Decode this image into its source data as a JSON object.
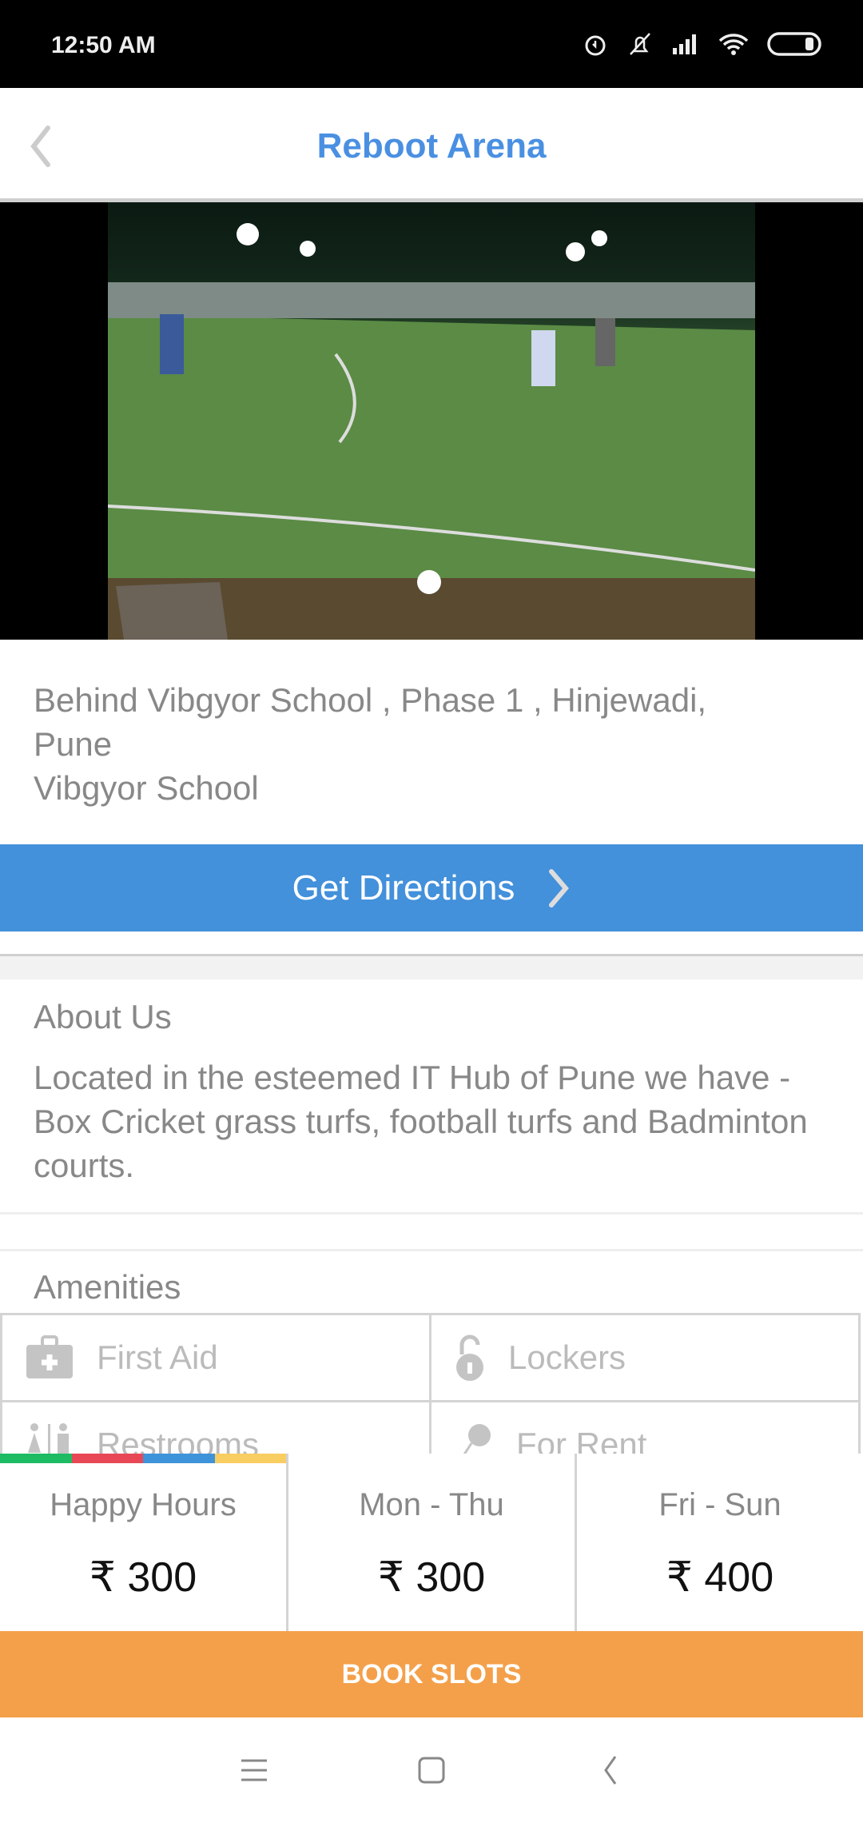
{
  "status_bar": {
    "time": "12:50 AM",
    "icons": [
      "alarm-icon",
      "mute-icon",
      "signal-icon",
      "wifi-icon",
      "battery-icon"
    ]
  },
  "header": {
    "title": "Reboot Arena",
    "back_icon": "chevron-left-icon"
  },
  "gallery": {
    "page_count": 1,
    "current_page": 1
  },
  "address": {
    "lines": [
      "Behind Vibgyor School , Phase 1 , Hinjewadi,",
      "Pune",
      "Vibgyor School"
    ]
  },
  "directions": {
    "label": "Get Directions"
  },
  "about": {
    "heading": "About Us",
    "text": "Located in the esteemed IT Hub of Pune we have - Box Cricket grass turfs, football turfs and Badminton courts."
  },
  "amenities": {
    "heading": "Amenities",
    "items": [
      {
        "label": "First Aid",
        "icon": "first-aid-icon"
      },
      {
        "label": "Lockers",
        "icon": "lock-icon"
      },
      {
        "label": "Restrooms",
        "icon": "restroom-icon"
      },
      {
        "label": "For Rent",
        "icon": "racket-icon"
      }
    ]
  },
  "prices": [
    {
      "label": "Happy Hours",
      "value": "₹ 300"
    },
    {
      "label": "Mon - Thu",
      "value": "₹ 300"
    },
    {
      "label": "Fri - Sun",
      "value": "₹ 400"
    }
  ],
  "strip_colors": [
    "#1dbb63",
    "#e84855",
    "#3f93d9",
    "#f8cd62"
  ],
  "book": {
    "label": "BOOK SLOTS"
  },
  "colors": {
    "accent": "#4a90e2",
    "button": "#4390db",
    "book": "#f4a04a"
  }
}
